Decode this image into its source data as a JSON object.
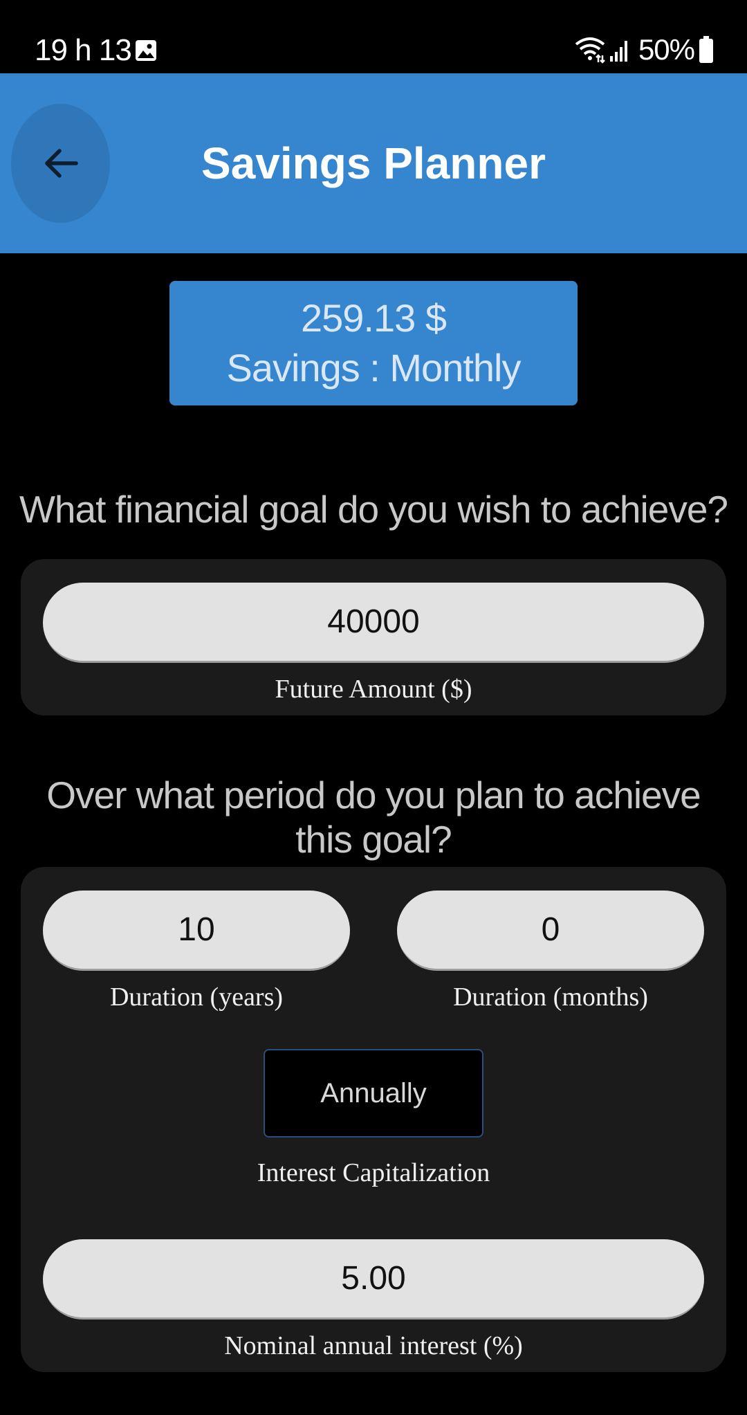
{
  "status_bar": {
    "time": "19 h 13",
    "battery": "50%",
    "icons": [
      "gallery-icon",
      "wifi-icon",
      "signal-icon",
      "battery-icon"
    ]
  },
  "app_bar": {
    "title": "Savings Planner",
    "back_icon": "arrow-left-icon",
    "color": "#3585cf"
  },
  "result": {
    "amount": "259.13 $",
    "frequency": "Savings : Monthly"
  },
  "goal_section": {
    "question": "What financial goal do you wish to achieve?",
    "future_amount": {
      "value": "40000",
      "label": "Future Amount ($)"
    }
  },
  "period_section": {
    "question": "Over what period do you plan to achieve this goal?",
    "duration_years": {
      "value": "10",
      "label": "Duration (years)"
    },
    "duration_months": {
      "value": "0",
      "label": "Duration (months)"
    },
    "interest_capitalization": {
      "selected": "Annually",
      "label": "Interest Capitalization"
    },
    "nominal_interest": {
      "value": "5.00",
      "label": "Nominal annual interest (%)"
    }
  }
}
